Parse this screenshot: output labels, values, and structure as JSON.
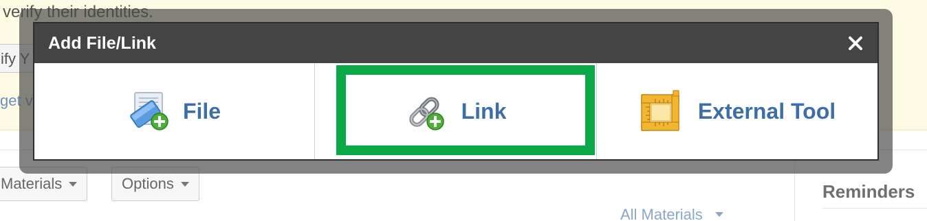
{
  "background": {
    "banner_text": "verify their identities.",
    "verify_button": "ify Y",
    "link_text": "get v",
    "materials_button": "Materials",
    "options_button": "Options",
    "all_materials": "All Materials",
    "reminders_heading": "Reminders"
  },
  "dialog": {
    "title": "Add File/Link",
    "close_icon": "close-icon",
    "options": [
      {
        "label": "File",
        "icon": "file-add-icon"
      },
      {
        "label": "Link",
        "icon": "link-add-icon",
        "highlighted": true
      },
      {
        "label": "External Tool",
        "icon": "external-tool-icon"
      }
    ]
  },
  "colors": {
    "header_bg": "#444444",
    "option_text": "#3d6ea8",
    "highlight": "#0aa847",
    "banner_bg": "#fdfbe3"
  }
}
